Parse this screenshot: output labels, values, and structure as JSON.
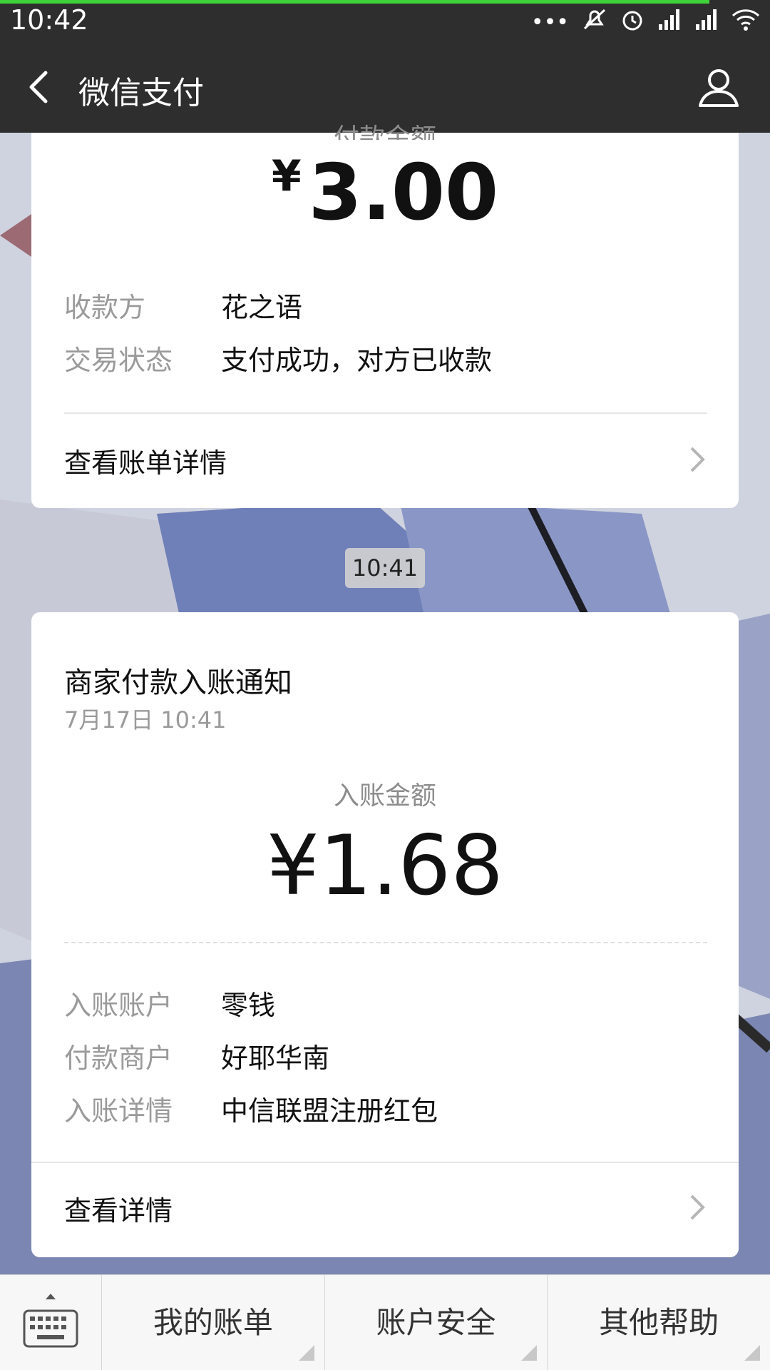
{
  "status_bar": {
    "time": "10:42",
    "icons": [
      "more-icon",
      "mute-icon",
      "alarm-icon",
      "signal-icon",
      "hd-signal-icon",
      "wifi-icon"
    ]
  },
  "nav": {
    "title": "微信支付",
    "back_icon": "back-arrow-icon",
    "user_icon": "user-icon"
  },
  "payment_card": {
    "amount_caption": "付款金额",
    "currency_symbol": "¥",
    "amount": "3.00",
    "rows": [
      {
        "label": "收款方",
        "value": "花之语"
      },
      {
        "label": "交易状态",
        "value": "支付成功，对方已收款"
      }
    ],
    "link_label": "查看账单详情"
  },
  "time_separator": "10:41",
  "income_card": {
    "title": "商家付款入账通知",
    "date": "7月17日  10:41",
    "amount_caption": "入账金额",
    "amount": "¥1.68",
    "rows": [
      {
        "label": "入账账户",
        "value": "零钱"
      },
      {
        "label": "付款商户",
        "value": "好耶华南"
      },
      {
        "label": "入账详情",
        "value": "中信联盟注册红包"
      }
    ],
    "link_label": "查看详情"
  },
  "bottom_bar": {
    "keyboard_icon": "keyboard-icon",
    "menus": [
      {
        "label": "我的账单"
      },
      {
        "label": "账户安全"
      },
      {
        "label": "其他帮助"
      }
    ]
  }
}
